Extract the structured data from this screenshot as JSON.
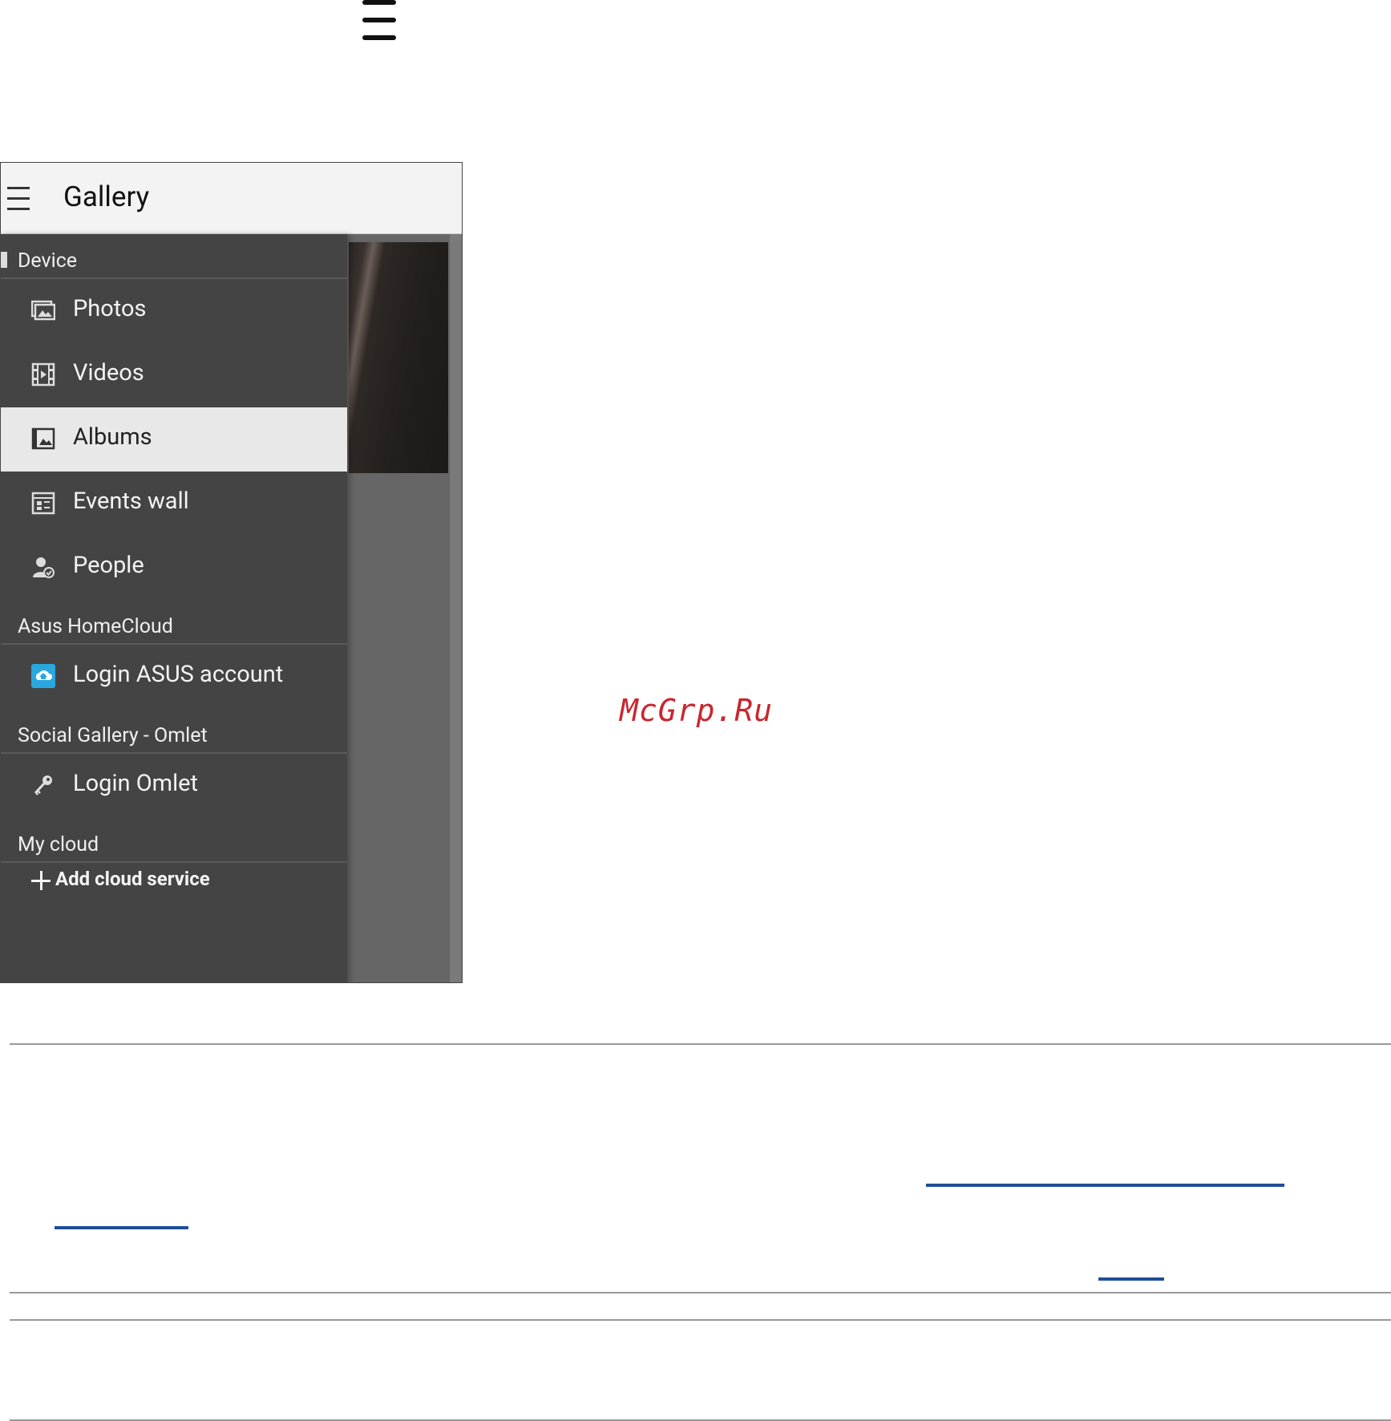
{
  "phone": {
    "app_title": "Gallery",
    "sections": {
      "device": "Device",
      "homecloud": "Asus HomeCloud",
      "social": "Social Gallery - Omlet",
      "mycloud": "My cloud"
    },
    "items": {
      "photos": "Photos",
      "videos": "Videos",
      "albums": "Albums",
      "events_wall": "Events wall",
      "people": "People",
      "login_asus": "Login ASUS account",
      "login_omlet": "Login Omlet",
      "add_cloud": "Add cloud service"
    },
    "active_item": "Albums"
  },
  "watermark": "McGrp.Ru",
  "colors": {
    "drawer_bg": "#444444",
    "active_bg": "#e8e8e8",
    "appbar_bg": "#f3f3f3",
    "link": "#1f4e9a",
    "watermark": "#c9262d",
    "homecloud_icon": "#29a8e0"
  }
}
